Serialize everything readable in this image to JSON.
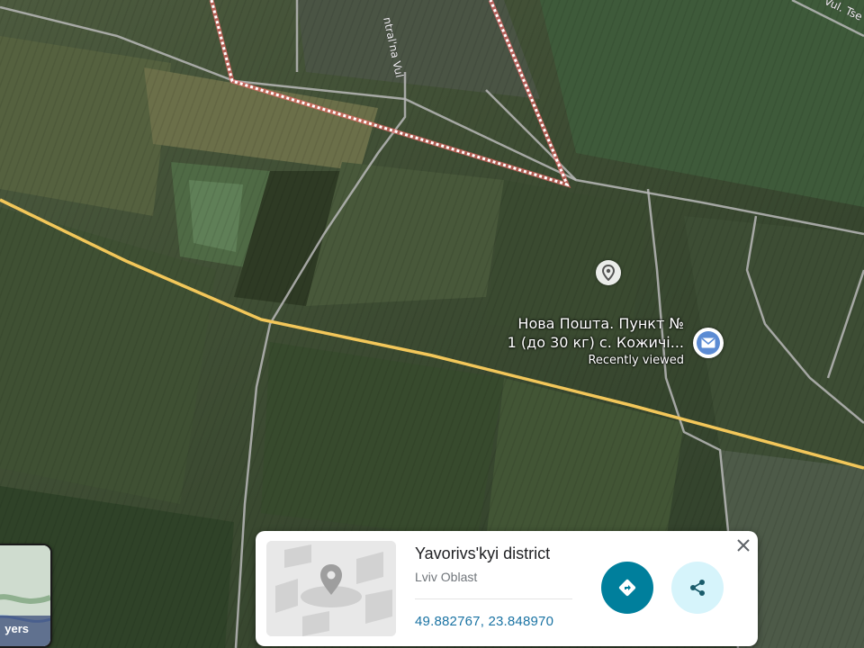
{
  "map": {
    "street_labels": [
      "ntral'na Vul",
      "Vul. Tse"
    ],
    "poi": {
      "name_line1": "Нова Пошта. Пункт №",
      "name_line2": "1 (до 30 кг) с. Кожичі...",
      "status": "Recently viewed",
      "icon": "mail-icon"
    },
    "pin_icon": "location-pin-icon",
    "boundary_color": "#ff6b6b",
    "highway_color": "#f3c75a"
  },
  "layers_button": {
    "label": "yers"
  },
  "place_card": {
    "title": "Yavorivs'kyi district",
    "subtitle": "Lviv Oblast",
    "coordinates": "49.882767, 23.848970",
    "directions_icon": "directions-icon",
    "share_icon": "share-icon",
    "close_icon": "close-icon",
    "accent_color": "#007f9c"
  }
}
